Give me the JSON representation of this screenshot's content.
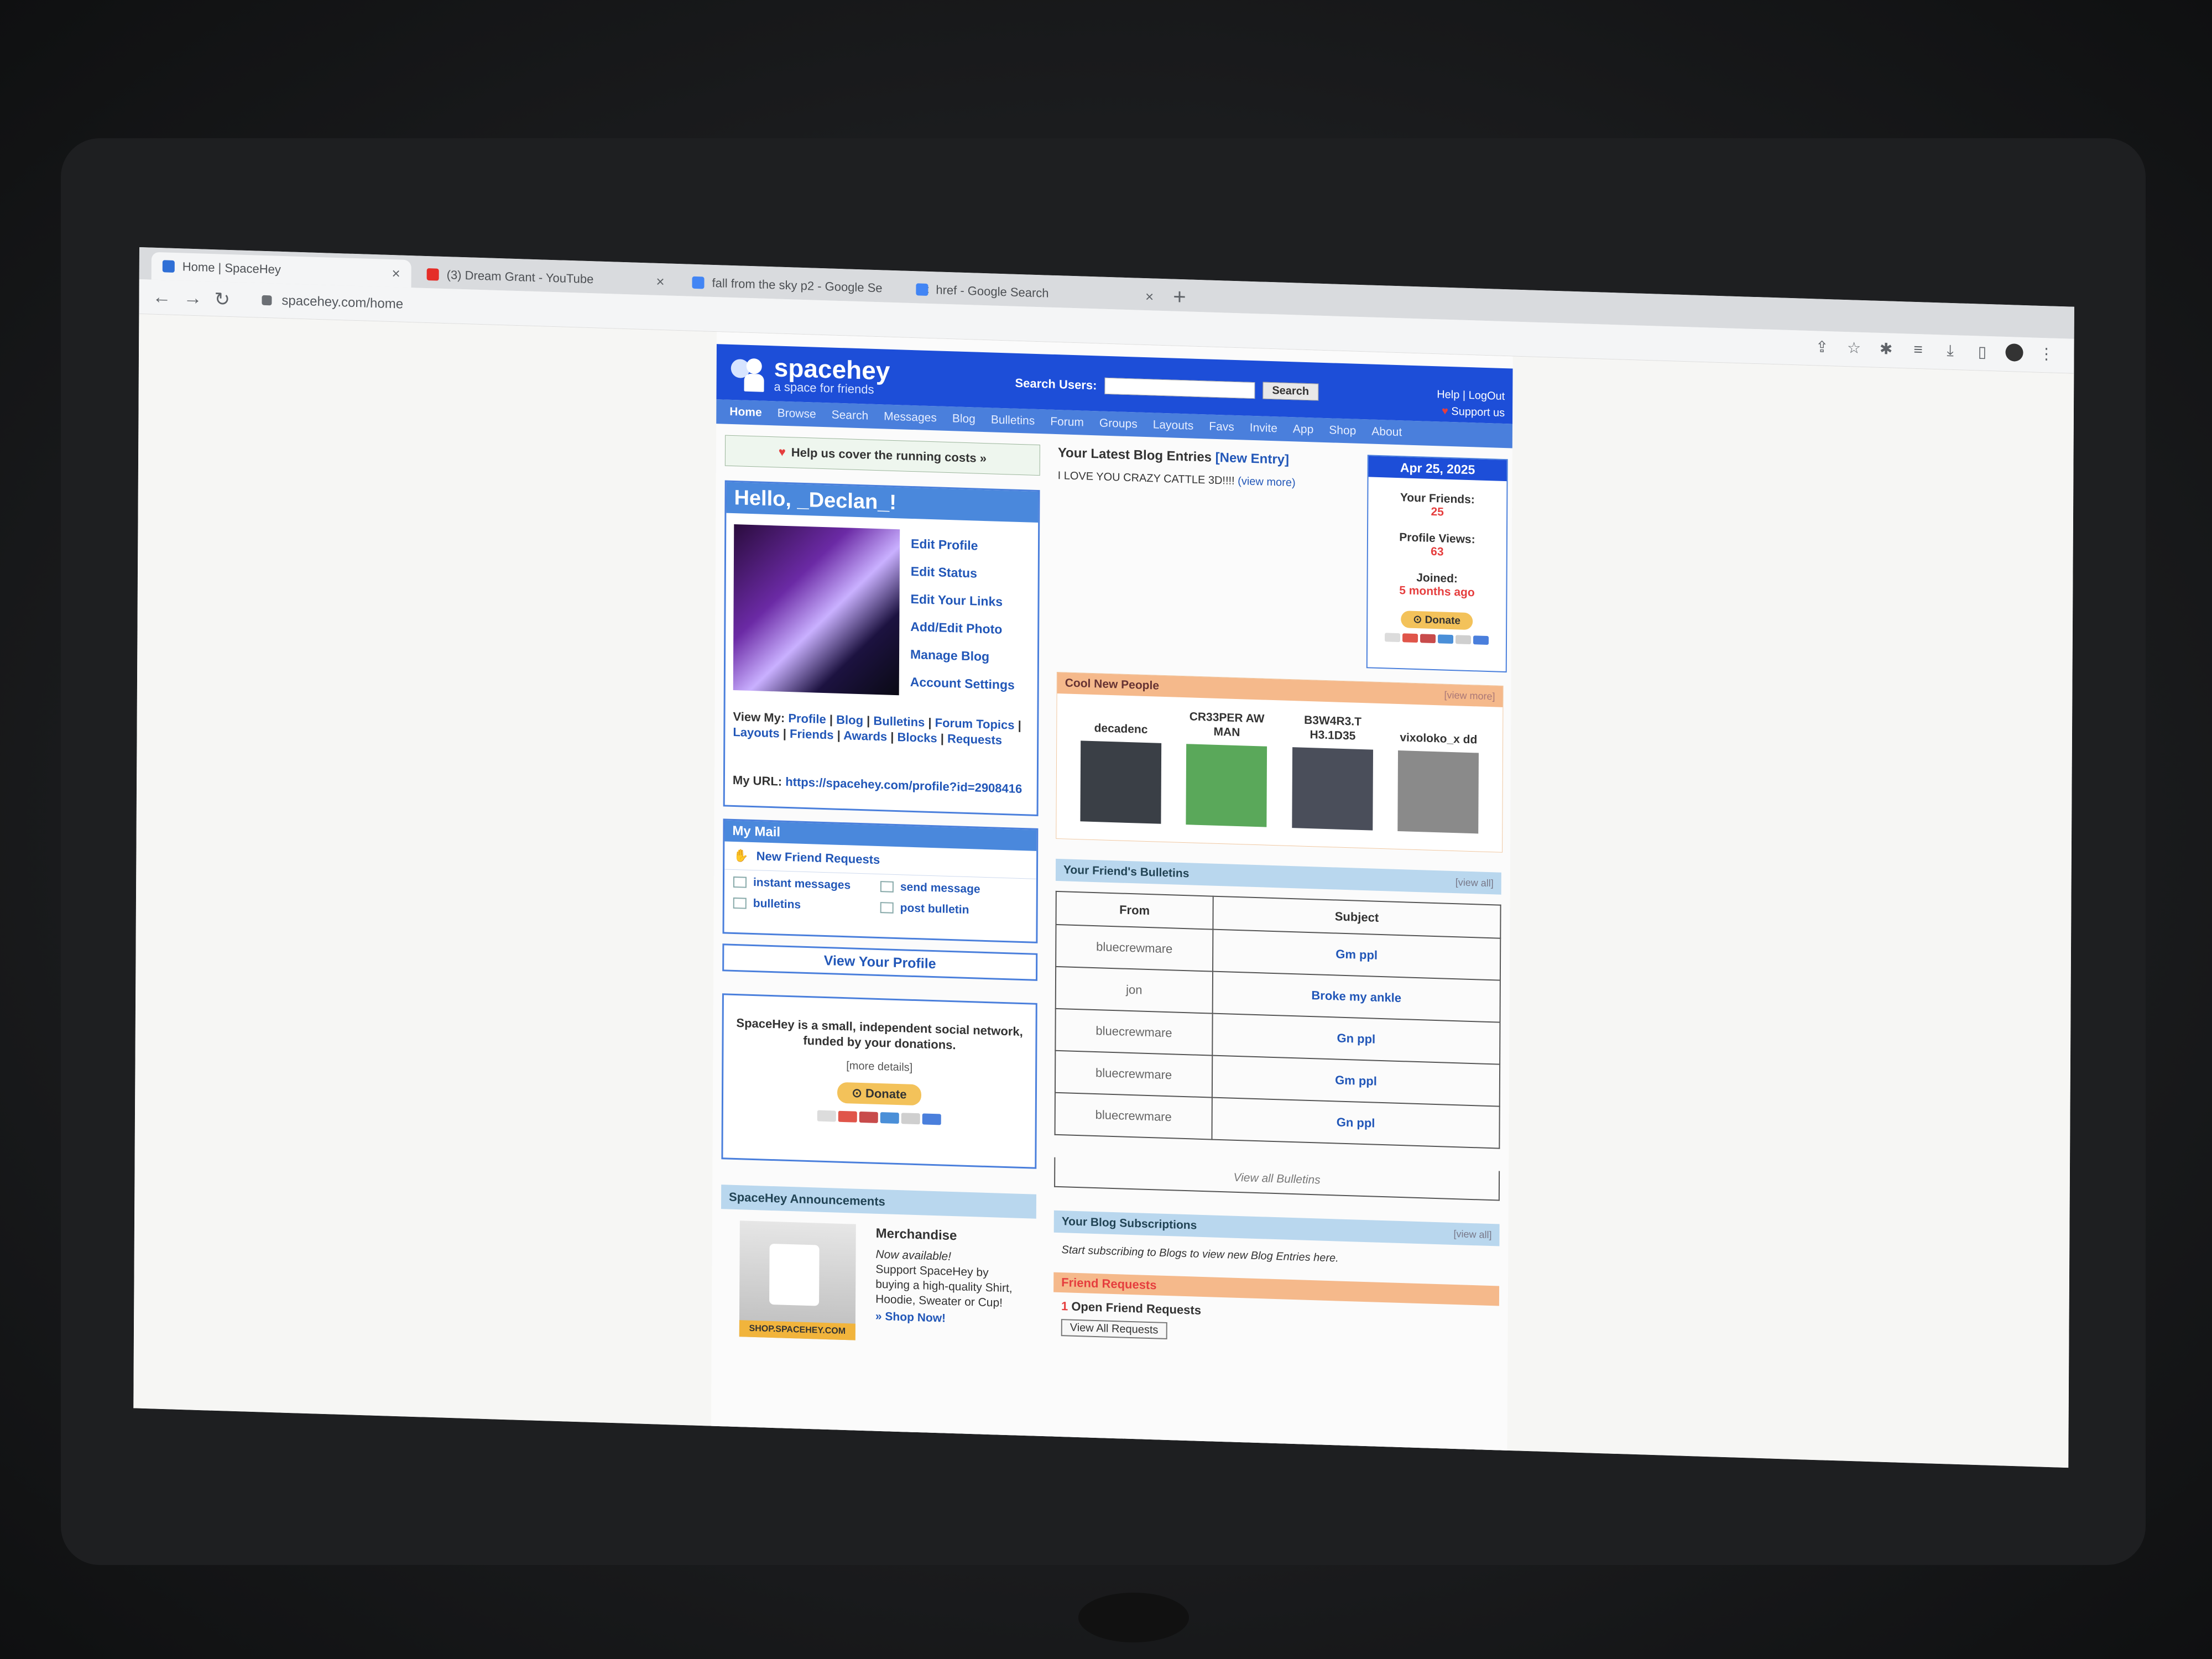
{
  "browser": {
    "tabs": [
      {
        "title": "Home | SpaceHey",
        "favicon_color": "#2f6fd6"
      },
      {
        "title": "(3) Dream Grant - YouTube",
        "favicon_color": "#e52d27"
      },
      {
        "title": "fall from the sky p2 - Google Se",
        "favicon_color": "#4285f4"
      },
      {
        "title": "href - Google Search",
        "favicon_color": "#4285f4"
      }
    ],
    "url": "spacehey.com/home"
  },
  "site": {
    "logo": {
      "name": "spacehey",
      "tagline": "a space for friends"
    },
    "search": {
      "label": "Search Users:",
      "button": "Search"
    },
    "header_links": {
      "help": "Help",
      "logout": "LogOut",
      "support": "Support us"
    },
    "nav": [
      "Home",
      "Browse",
      "Search",
      "Messages",
      "Blog",
      "Bulletins",
      "Forum",
      "Groups",
      "Layouts",
      "Favs",
      "Invite",
      "App",
      "Shop",
      "About"
    ]
  },
  "left": {
    "help_banner": "Help us cover the running costs »",
    "hello_title": "Hello, _Declan_!",
    "profile_links": [
      "Edit Profile",
      "Edit Status",
      "Edit Your Links",
      "Add/Edit Photo",
      "Manage Blog",
      "Account Settings"
    ],
    "view_my_label": "View My:",
    "view_my_links": [
      "Profile",
      "Blog",
      "Bulletins",
      "Forum Topics",
      "Layouts",
      "Friends",
      "Awards",
      "Blocks",
      "Requests"
    ],
    "my_url_label": "My URL:",
    "my_url": "https://spacehey.com/profile?id=2908416",
    "mail": {
      "title": "My Mail",
      "new_friend_requests": "New Friend Requests",
      "items": [
        "instant messages",
        "send message",
        "bulletins",
        "post bulletin"
      ]
    },
    "view_profile": "View Your Profile",
    "donate_box": {
      "text": "SpaceHey is a small, independent social network, funded by your donations.",
      "more": "[more details]",
      "button": "Donate"
    },
    "announcements": {
      "title": "SpaceHey Announcements",
      "heading": "Merchandise",
      "line1": "Now available!",
      "body": "Support SpaceHey by buying a high-quality Shirt, Hoodie, Sweater or Cup!",
      "link": "» Shop Now!",
      "image_caption": "SHOP.SPACEHEY.COM"
    }
  },
  "right": {
    "blog_title": "Your Latest Blog Entries",
    "new_entry": "[New Entry]",
    "blog_entry": "I LOVE YOU CRAZY CATTLE 3D!!!!",
    "view_more_entry": "(view more)",
    "stats": {
      "date": "Apr 25, 2025",
      "friends_label": "Your Friends:",
      "friends": "25",
      "views_label": "Profile Views:",
      "views": "63",
      "joined_label": "Joined:",
      "joined": "5 months ago",
      "donate": "Donate"
    },
    "cool_people": {
      "title": "Cool New People",
      "view_more": "[view more]",
      "people": [
        {
          "name": "decadenc",
          "color": "#3a3f46"
        },
        {
          "name": "CR33PER AW MAN",
          "color": "#5aa85a"
        },
        {
          "name": "B3W4R3.T H3.1D35",
          "color": "#4a4e5a"
        },
        {
          "name": "vixoloko_x dd",
          "color": "#8a8a8a"
        }
      ]
    },
    "bulletins": {
      "title": "Your Friend's Bulletins",
      "view_all": "[view all]",
      "headers": [
        "From",
        "Subject"
      ],
      "rows": [
        {
          "from": "bluecrewmare",
          "subject": "Gm ppl"
        },
        {
          "from": "jon",
          "subject": "Broke my ankle"
        },
        {
          "from": "bluecrewmare",
          "subject": "Gn ppl"
        },
        {
          "from": "bluecrewmare",
          "subject": "Gm ppl"
        },
        {
          "from": "bluecrewmare",
          "subject": "Gn ppl"
        }
      ],
      "view_all_link": "View all Bulletins"
    },
    "subscriptions": {
      "title": "Your Blog Subscriptions",
      "view_all": "[view all]",
      "text": "Start subscribing to Blogs to view new Blog Entries here."
    },
    "friend_requests": {
      "title": "Friend Requests",
      "count": "1",
      "open_text": "Open Friend Requests",
      "button": "View All Requests"
    }
  },
  "colors": {
    "brand_blue": "#1d4ed8",
    "nav_blue": "#4a7fdc",
    "orange": "#f5b98b",
    "light_blue": "#b9d7ee",
    "red": "#e53e3e"
  }
}
